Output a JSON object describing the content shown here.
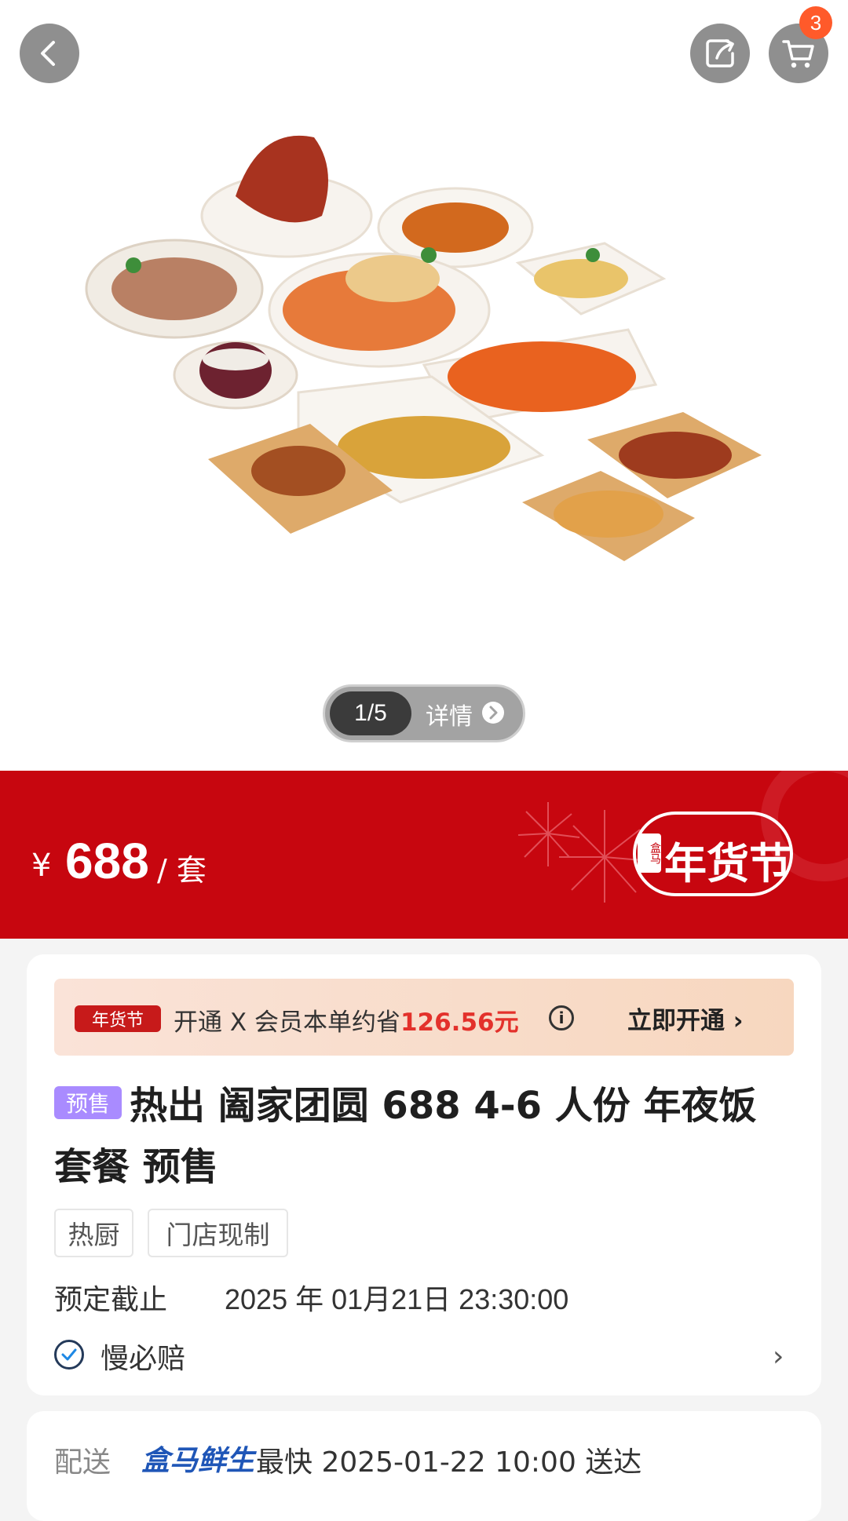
{
  "header": {
    "back_icon": "chevron-left-icon",
    "share_icon": "share-icon",
    "cart_icon": "cart-icon",
    "cart_count": "3"
  },
  "gallery": {
    "counter": "1/5",
    "detail_label": "详情"
  },
  "price": {
    "currency": "¥",
    "value": "688",
    "unit": "/ 套",
    "festival_badge": "年货节",
    "brand_mark": "盒马"
  },
  "member": {
    "tag": "年货节",
    "text": "开通 X 会员本单约省",
    "saving": "126.56元",
    "cta": "立即开通 ›"
  },
  "product": {
    "presale_tag": "预售",
    "title": "热出 阖家团圆 688 4-6 人份 年夜饭套餐 预售",
    "chips": [
      "热厨",
      "门店现制"
    ],
    "deadline_label": "预定截止",
    "deadline_value": "2025 年 01月21日 23:30:00",
    "guarantee": "慢必赔"
  },
  "delivery": {
    "label": "配送",
    "brand": "盒马鲜生",
    "text": "最快 2025-01-22 10:00 送达"
  },
  "colors": {
    "accent_red": "#c7060f",
    "saving_red": "#e3312b",
    "presale_purple": "#a98bff",
    "brand_blue": "#1f56b7"
  }
}
